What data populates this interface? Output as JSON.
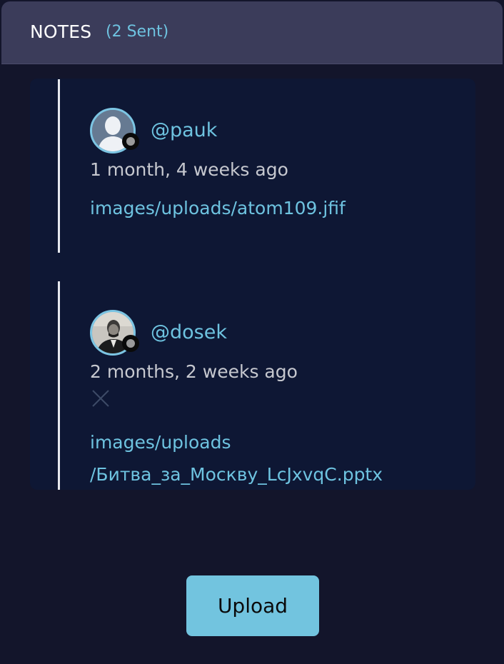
{
  "header": {
    "title": "NOTES",
    "count": "(2 Sent)"
  },
  "notes": [
    {
      "username": "@pauk",
      "timestamp": "1 month, 4 weeks ago",
      "file_line1": "images/uploads/atom109.jfif",
      "avatar_icon": "default-user-avatar",
      "status_color": "#9a9a9a"
    },
    {
      "username": "@dosek",
      "timestamp": "2 months, 2 weeks ago",
      "remove_icon": "close-icon",
      "file_line1": "images/uploads",
      "file_line2": "/Битва_за_Москву_LcJxvqC.pptx",
      "avatar_icon": "photo-avatar",
      "status_color": "#9a9a9a"
    }
  ],
  "actions": {
    "upload_label": "Upload"
  },
  "colors": {
    "accent": "#6ec3e0",
    "header_bg": "#3b3c5a",
    "panel_bg": "#13152b",
    "notes_bg": "#0e1734",
    "button_bg": "#72c4df"
  }
}
